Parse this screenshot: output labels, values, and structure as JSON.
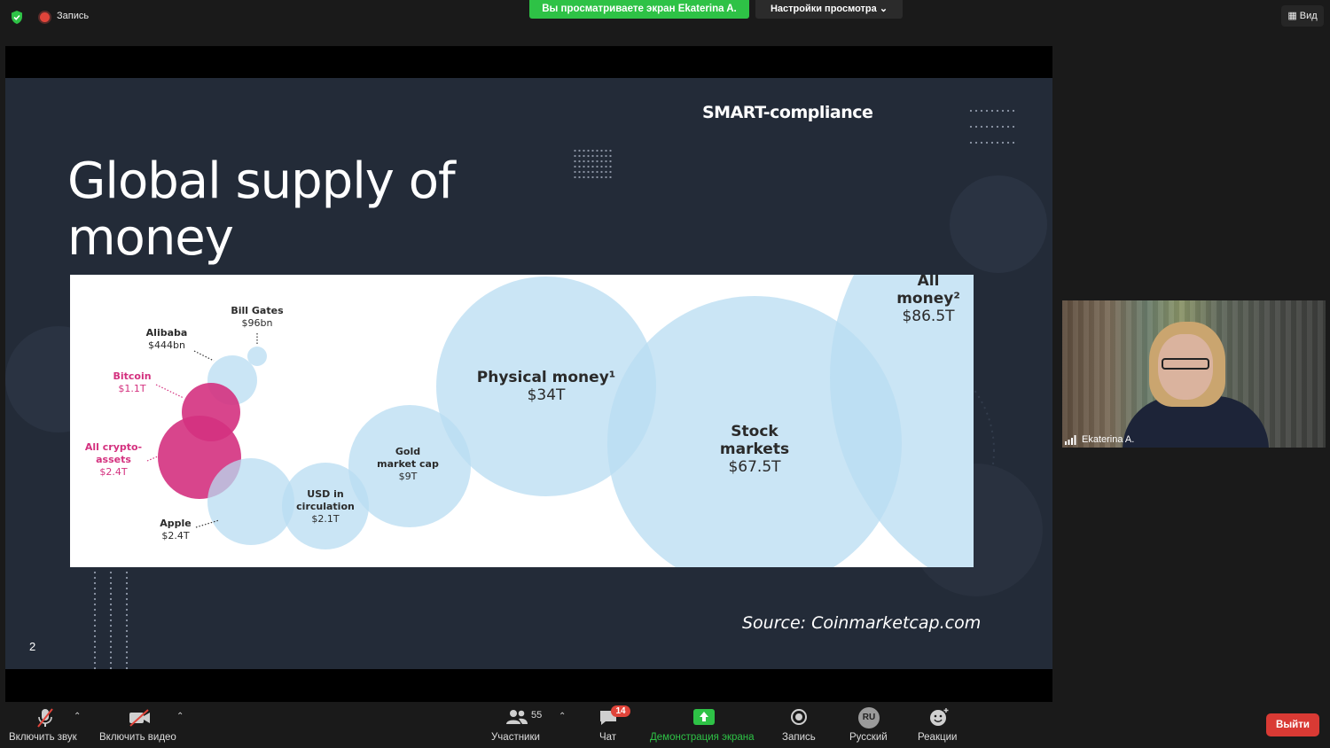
{
  "top_bar": {
    "recording_label": "Запись",
    "share_banner": "Вы просматриваете экран Ekaterina A.",
    "view_settings": "Настройки просмотра",
    "view_button": "Вид"
  },
  "slide": {
    "brand": "SMART-compliance",
    "title": "Global supply of money",
    "source": "Source: Coinmarketcap.com",
    "page_number": "2"
  },
  "chart_data": {
    "type": "bubble",
    "title": "",
    "unit": "USD",
    "items": [
      {
        "name": "Bill Gates",
        "value_label": "$96bn",
        "value": 0.096,
        "color": "#b8dcf2"
      },
      {
        "name": "Alibaba",
        "value_label": "$444bn",
        "value": 0.444,
        "color": "#b8dcf2"
      },
      {
        "name": "Bitcoin",
        "value_label": "$1.1T",
        "value": 1.1,
        "color": "#d4317f"
      },
      {
        "name": "All crypto-assets",
        "value_label": "$2.4T",
        "value": 2.4,
        "color": "#d4317f"
      },
      {
        "name": "Apple",
        "value_label": "$2.4T",
        "value": 2.4,
        "color": "#b8dcf2"
      },
      {
        "name": "USD in circulation",
        "value_label": "$2.1T",
        "value": 2.1,
        "color": "#b8dcf2"
      },
      {
        "name": "Gold market cap",
        "value_label": "$9T",
        "value": 9,
        "color": "#b8dcf2"
      },
      {
        "name": "Physical money",
        "footnote": "1",
        "value_label": "$34T",
        "value": 34,
        "color": "#b8dcf2"
      },
      {
        "name": "Stock markets",
        "value_label": "$67.5T",
        "value": 67.5,
        "color": "#b8dcf2"
      },
      {
        "name": "All money",
        "footnote": "2",
        "value_label": "$86.5T",
        "value": 86.5,
        "color": "#b8dcf2"
      }
    ]
  },
  "video": {
    "participant_name": "Ekaterina A."
  },
  "toolbar": {
    "unmute": "Включить звук",
    "start_video": "Включить видео",
    "participants": "Участники",
    "participants_count": "55",
    "chat": "Чат",
    "chat_badge": "14",
    "share_screen": "Демонстрация экрана",
    "record": "Запись",
    "language": "Русский",
    "language_code": "RU",
    "reactions": "Реакции",
    "leave": "Выйти"
  },
  "colors": {
    "share_green": "#2ec246",
    "leave_red": "#d93a34",
    "slide_bg": "#232b38",
    "bubble_blue": "#b8dcf2",
    "bubble_pink": "#d4317f"
  }
}
